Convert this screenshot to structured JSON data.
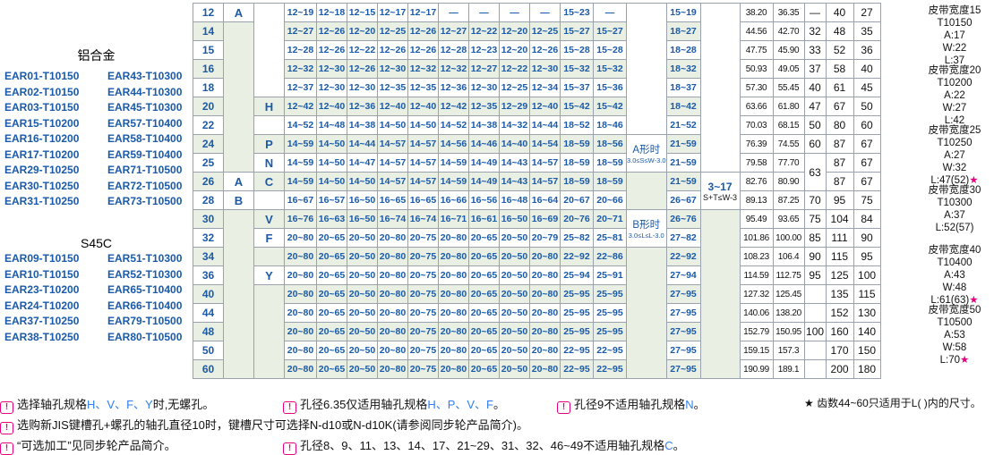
{
  "groups": [
    {
      "title": "铝合金",
      "parts": [
        [
          "EAR01-T10150",
          "EAR43-T10300"
        ],
        [
          "EAR02-T10150",
          "EAR44-T10300"
        ],
        [
          "EAR03-T10150",
          "EAR45-T10300"
        ],
        [
          "EAR15-T10200",
          "EAR57-T10400"
        ],
        [
          "EAR16-T10200",
          "EAR58-T10400"
        ],
        [
          "EAR17-T10200",
          "EAR59-T10400"
        ],
        [
          "EAR29-T10250",
          "EAR71-T10500"
        ],
        [
          "EAR30-T10250",
          "EAR72-T10500"
        ],
        [
          "EAR31-T10250",
          "EAR73-T10500"
        ]
      ]
    },
    {
      "title": "S45C",
      "parts": [
        [
          "EAR09-T10150",
          "EAR51-T10300"
        ],
        [
          "EAR10-T10150",
          "EAR52-T10300"
        ],
        [
          "EAR23-T10200",
          "EAR65-T10400"
        ],
        [
          "EAR24-T10200",
          "EAR66-T10400"
        ],
        [
          "EAR37-T10250",
          "EAR79-T10500"
        ],
        [
          "EAR38-T10250",
          "EAR80-T10500"
        ]
      ]
    }
  ],
  "teeth": [
    "12",
    "14",
    "15",
    "16",
    "18",
    "20",
    "22",
    "24",
    "25",
    "26",
    "28",
    "30",
    "32",
    "34",
    "36",
    "40",
    "44",
    "48",
    "50",
    "60"
  ],
  "rows": [
    [
      "12~19",
      "12~18",
      "12~15",
      "12~17",
      "12~17",
      "—",
      "—",
      "—",
      "—",
      "15~23",
      "—",
      "15~19"
    ],
    [
      "12~27",
      "12~26",
      "12~20",
      "12~25",
      "12~26",
      "12~27",
      "12~22",
      "12~20",
      "12~25",
      "15~27",
      "15~27",
      "18~27"
    ],
    [
      "12~28",
      "12~26",
      "12~22",
      "12~26",
      "12~26",
      "12~28",
      "12~23",
      "12~20",
      "12~26",
      "15~28",
      "15~28",
      "18~28"
    ],
    [
      "12~32",
      "12~30",
      "12~26",
      "12~30",
      "12~32",
      "12~32",
      "12~27",
      "12~22",
      "12~30",
      "15~32",
      "15~32",
      "18~32"
    ],
    [
      "12~37",
      "12~30",
      "12~30",
      "12~35",
      "12~35",
      "12~36",
      "12~30",
      "12~25",
      "12~34",
      "15~37",
      "15~36",
      "18~37"
    ],
    [
      "12~42",
      "12~40",
      "12~36",
      "12~40",
      "12~40",
      "12~42",
      "12~35",
      "12~29",
      "12~40",
      "15~42",
      "15~42",
      "18~42"
    ],
    [
      "14~52",
      "14~48",
      "14~38",
      "14~50",
      "14~50",
      "14~52",
      "14~38",
      "14~32",
      "14~44",
      "18~52",
      "18~46",
      "21~52"
    ],
    [
      "14~59",
      "14~50",
      "14~44",
      "14~57",
      "14~57",
      "14~56",
      "14~46",
      "14~40",
      "14~54",
      "18~59",
      "18~56",
      "21~59"
    ],
    [
      "14~59",
      "14~50",
      "14~47",
      "14~57",
      "14~57",
      "14~59",
      "14~49",
      "14~43",
      "14~57",
      "18~59",
      "18~59",
      "21~59"
    ],
    [
      "14~59",
      "14~50",
      "14~50",
      "14~57",
      "14~57",
      "14~59",
      "14~49",
      "14~43",
      "14~57",
      "18~59",
      "18~59",
      "21~59"
    ],
    [
      "16~67",
      "16~57",
      "16~50",
      "16~65",
      "16~65",
      "16~66",
      "16~56",
      "16~48",
      "16~64",
      "20~67",
      "20~66",
      "26~67"
    ],
    [
      "16~76",
      "16~63",
      "16~50",
      "16~74",
      "16~74",
      "16~71",
      "16~61",
      "16~50",
      "16~69",
      "20~76",
      "20~71",
      "26~76"
    ],
    [
      "20~80",
      "20~65",
      "20~50",
      "20~80",
      "20~75",
      "20~80",
      "20~65",
      "20~50",
      "20~79",
      "25~82",
      "25~81",
      "27~82"
    ],
    [
      "20~80",
      "20~65",
      "20~50",
      "20~80",
      "20~75",
      "20~80",
      "20~65",
      "20~50",
      "20~80",
      "22~92",
      "22~86",
      "22~92"
    ],
    [
      "20~80",
      "20~65",
      "20~50",
      "20~80",
      "20~75",
      "20~80",
      "20~65",
      "20~50",
      "20~80",
      "25~94",
      "25~91",
      "27~94"
    ],
    [
      "20~80",
      "20~65",
      "20~50",
      "20~80",
      "20~75",
      "20~80",
      "20~65",
      "20~50",
      "20~80",
      "25~95",
      "25~95",
      "27~95"
    ],
    [
      "20~80",
      "20~65",
      "20~50",
      "20~80",
      "20~75",
      "20~80",
      "20~65",
      "20~50",
      "20~80",
      "25~95",
      "25~95",
      "27~95"
    ],
    [
      "20~80",
      "20~65",
      "20~50",
      "20~80",
      "20~75",
      "20~80",
      "20~65",
      "20~50",
      "20~80",
      "25~95",
      "25~95",
      "27~95"
    ],
    [
      "20~80",
      "20~65",
      "20~50",
      "20~80",
      "20~75",
      "20~80",
      "20~65",
      "20~50",
      "20~80",
      "22~95",
      "22~95",
      "27~95"
    ],
    [
      "20~80",
      "20~65",
      "20~50",
      "20~80",
      "20~75",
      "20~80",
      "20~65",
      "20~50",
      "20~80",
      "22~95",
      "22~95",
      "27~95"
    ]
  ],
  "dims": [
    [
      "38.20",
      "36.35",
      "—",
      "40",
      "27"
    ],
    [
      "44.56",
      "42.70",
      "32",
      "48",
      "35"
    ],
    [
      "47.75",
      "45.90",
      "33",
      "52",
      "36"
    ],
    [
      "50.93",
      "49.05",
      "37",
      "58",
      "40"
    ],
    [
      "57.30",
      "55.45",
      "40",
      "61",
      "45"
    ],
    [
      "63.66",
      "61.80",
      "47",
      "67",
      "50"
    ],
    [
      "70.03",
      "68.15",
      "50",
      "80",
      "60"
    ],
    [
      "76.39",
      "74.55",
      "60",
      "87",
      "67"
    ],
    [
      "79.58",
      "77.70",
      "",
      "87",
      "67"
    ],
    [
      "82.76",
      "80.90",
      "63",
      "87",
      "67"
    ],
    [
      "89.13",
      "87.25",
      "70",
      "95",
      "75"
    ],
    [
      "95.49",
      "93.65",
      "75",
      "104",
      "84"
    ],
    [
      "101.86",
      "100.00",
      "85",
      "111",
      "90"
    ],
    [
      "108.23",
      "106.4",
      "90",
      "115",
      "95"
    ],
    [
      "114.59",
      "112.75",
      "95",
      "125",
      "100"
    ],
    [
      "127.32",
      "125.45",
      "",
      "135",
      "115"
    ],
    [
      "140.06",
      "138.20",
      "",
      "152",
      "130"
    ],
    [
      "152.79",
      "150.95",
      "100",
      "160",
      "140"
    ],
    [
      "159.15",
      "157.3",
      "",
      "170",
      "150"
    ],
    [
      "190.99",
      "189.1",
      "",
      "200",
      "180"
    ]
  ],
  "letters": {
    "a_top": "A",
    "a_mid": "A",
    "b": "B",
    "hpnc": [
      "H",
      "P",
      "N",
      "C",
      "V",
      "F",
      "Y"
    ]
  },
  "notes": {
    "a_shape": "A形时",
    "a_cond": "3.0≤S≤W-3.0",
    "b_shape": "B形时",
    "b_cond": "3.0≤L≤L-3.0",
    "s_range": "3~17",
    "s_cond": "S+T≤W-3"
  },
  "belts": [
    {
      "lines": [
        "皮带宽度15",
        "T10150",
        "A:17",
        "W:22",
        "L:37"
      ]
    },
    {
      "lines": [
        "皮带宽度20",
        "T10200",
        "A:22",
        "W:27",
        "L:42"
      ]
    },
    {
      "lines": [
        "皮带宽度25",
        "T10250",
        "A:27",
        "W:32",
        "L:47(52)"
      ],
      "star": true
    },
    {
      "lines": [
        "皮带宽度30",
        "T10300",
        "A:37",
        "L:52(57)"
      ]
    },
    {
      "lines": [
        "皮带宽度40",
        "T10400",
        "A:43",
        "W:48",
        "L:61(63)"
      ],
      "star": true
    },
    {
      "lines": [
        "皮带宽度50",
        "T10500",
        "A:53",
        "W:58",
        "L:70"
      ],
      "star": true
    }
  ],
  "footnotes": {
    "n1_a": "选择轴孔规格",
    "n1_b": "H、V、F、Y",
    "n1_c": "时,无螺孔。",
    "n2_a": "孔径6.35仅适用轴孔规格",
    "n2_b": "H、P、V、F",
    "n2_c": "。",
    "n3_a": "孔径9不适用轴孔规格",
    "n3_b": "N",
    "n3_c": "。",
    "n4": "选购新JIS键槽孔+螺孔的轴孔直径10时，键槽尺寸可选择N-d10或N-d10K(请参阅同步轮产品简介)。",
    "n5": "“可选加工”见同步轮产品简介。",
    "n6_a": "孔径8、9、11、13、14、17、21~29、31、32、46~49不适用轴孔规格",
    "n6_b": "C",
    "n6_c": "。",
    "star": "★ 齿数44~60只适用于L( )内的尺寸。",
    "icon": "!"
  }
}
